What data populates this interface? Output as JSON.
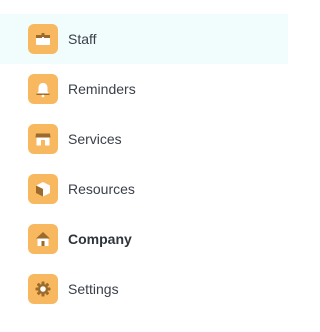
{
  "menu": {
    "items": [
      {
        "label": "Staff",
        "icon": "staff-icon",
        "active": true,
        "bold": false
      },
      {
        "label": "Reminders",
        "icon": "bell-icon",
        "active": false,
        "bold": false
      },
      {
        "label": "Services",
        "icon": "shop-icon",
        "active": false,
        "bold": false
      },
      {
        "label": "Resources",
        "icon": "box-icon",
        "active": false,
        "bold": false
      },
      {
        "label": "Company",
        "icon": "house-icon",
        "active": false,
        "bold": true
      },
      {
        "label": "Settings",
        "icon": "gear-icon",
        "active": false,
        "bold": false
      }
    ]
  },
  "colors": {
    "tile": "#f7b860",
    "tile_detail": "#ffffff",
    "tile_dark": "#9c6a2a",
    "active_row": "#f1fcfd",
    "text": "#3a3f48"
  }
}
